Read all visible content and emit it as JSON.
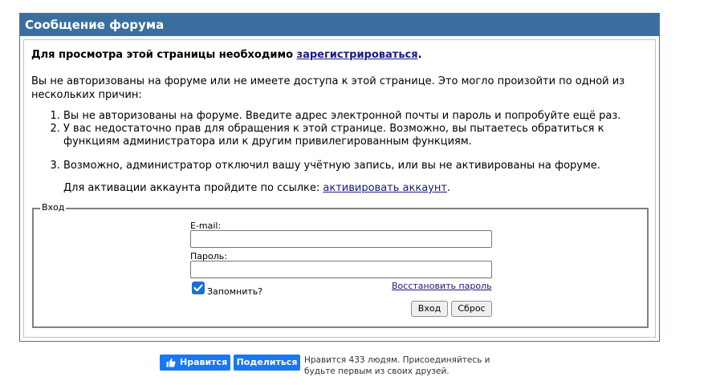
{
  "panel": {
    "title": "Сообщение форума",
    "notice_prefix": "Для просмотра этой страницы необходимо",
    "notice_link": "зарегистрироваться",
    "notice_suffix": ".",
    "intro": "Вы не авторизованы на форуме или не имеете доступа к этой странице. Это могло произойти по одной из нескольких причин:",
    "reasons": [
      "Вы не авторизованы на форуме. Введите адрес электронной почты и пароль и попробуйте ещё раз.",
      "У вас недостаточно прав для обращения к этой странице. Возможно, вы пытаетесь обратиться к функциям администратора или к другим привилегированным функциям.",
      "Возможно, администратор отключил вашу учётную запись, или вы не активированы на форуме."
    ],
    "activate_prefix": "Для активации аккаунта пройдите по ссылке:",
    "activate_link": "активировать аккаунт",
    "activate_suffix": "."
  },
  "login": {
    "legend": "Вход",
    "email_label": "E-mail:",
    "email_value": "",
    "password_label": "Пароль:",
    "password_value": "",
    "remember_label": "Запомнить?",
    "remember_checked": true,
    "restore_link": "Восстановить пароль",
    "submit_label": "Вход",
    "reset_label": "Сброс"
  },
  "facebook": {
    "like_label": "Нравится",
    "share_label": "Поделиться",
    "social_text": "Нравится 433 людям. Присоединяйтесь и будьте первым из своих друзей."
  },
  "colors": {
    "header_bg": "#3a6e9e",
    "link": "#1a1a80",
    "facebook_blue": "#1877f2",
    "checkbox": "#1a6fd1"
  }
}
